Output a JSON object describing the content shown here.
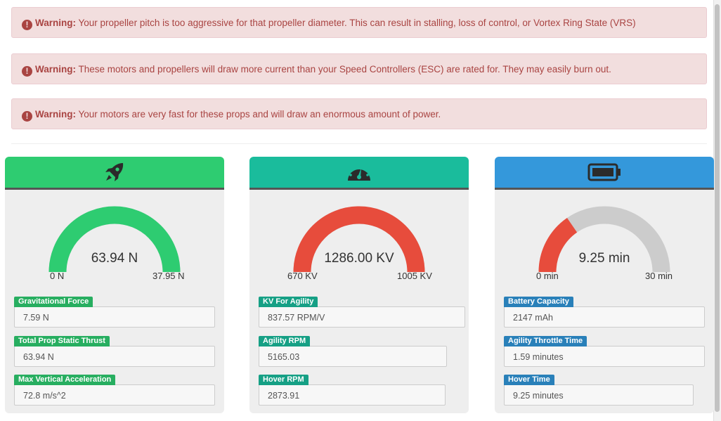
{
  "alerts": [
    {
      "label": "Warning:",
      "text": " Your propeller pitch is too aggressive for that propeller diameter. This can result in stalling, loss of control, or Vortex Ring State (VRS)"
    },
    {
      "label": "Warning:",
      "text": " These motors and propellers will draw more current than your Speed Controllers (ESC) are rated for. They may easily burn out."
    },
    {
      "label": "Warning:",
      "text": " Your motors are very fast for these props and will draw an enormous amount of power."
    }
  ],
  "colors": {
    "green": "#2ecc71",
    "teal": "#1abc9c",
    "blue": "#3498db",
    "red": "#e74c3c",
    "gray": "#cccccc",
    "label_green": "#27ae60",
    "label_teal": "#16a085",
    "label_blue": "#2980b9"
  },
  "panels": [
    {
      "icon": "rocket-icon",
      "gauge": {
        "value_text": "63.94 N",
        "min": "0 N",
        "max": "37.95 N",
        "fill_fraction": 1.0
      },
      "fields": [
        {
          "label": "Gravitational Force",
          "value": "7.59 N"
        },
        {
          "label": "Total Prop Static Thrust",
          "value": "63.94 N"
        },
        {
          "label": "Max Vertical Acceleration",
          "value": "72.8 m/s^2"
        }
      ]
    },
    {
      "icon": "speedometer-icon",
      "gauge": {
        "value_text": "1286.00 KV",
        "min": "670 KV",
        "max": "1005 KV",
        "fill_fraction": 1.0
      },
      "fields": [
        {
          "label": "KV For Agility",
          "value": "837.57 RPM/V"
        },
        {
          "label": "Agility RPM",
          "value": "5165.03"
        },
        {
          "label": "Hover RPM",
          "value": "2873.91"
        }
      ]
    },
    {
      "icon": "battery-icon",
      "gauge": {
        "value_text": "9.25 min",
        "min": "0 min",
        "max": "30 min",
        "fill_fraction": 0.308
      },
      "fields": [
        {
          "label": "Battery Capacity",
          "value": "2147 mAh"
        },
        {
          "label": "Agility Throttle Time",
          "value": "1.59 minutes"
        },
        {
          "label": "Hover Time",
          "value": "9.25 minutes"
        }
      ]
    }
  ]
}
